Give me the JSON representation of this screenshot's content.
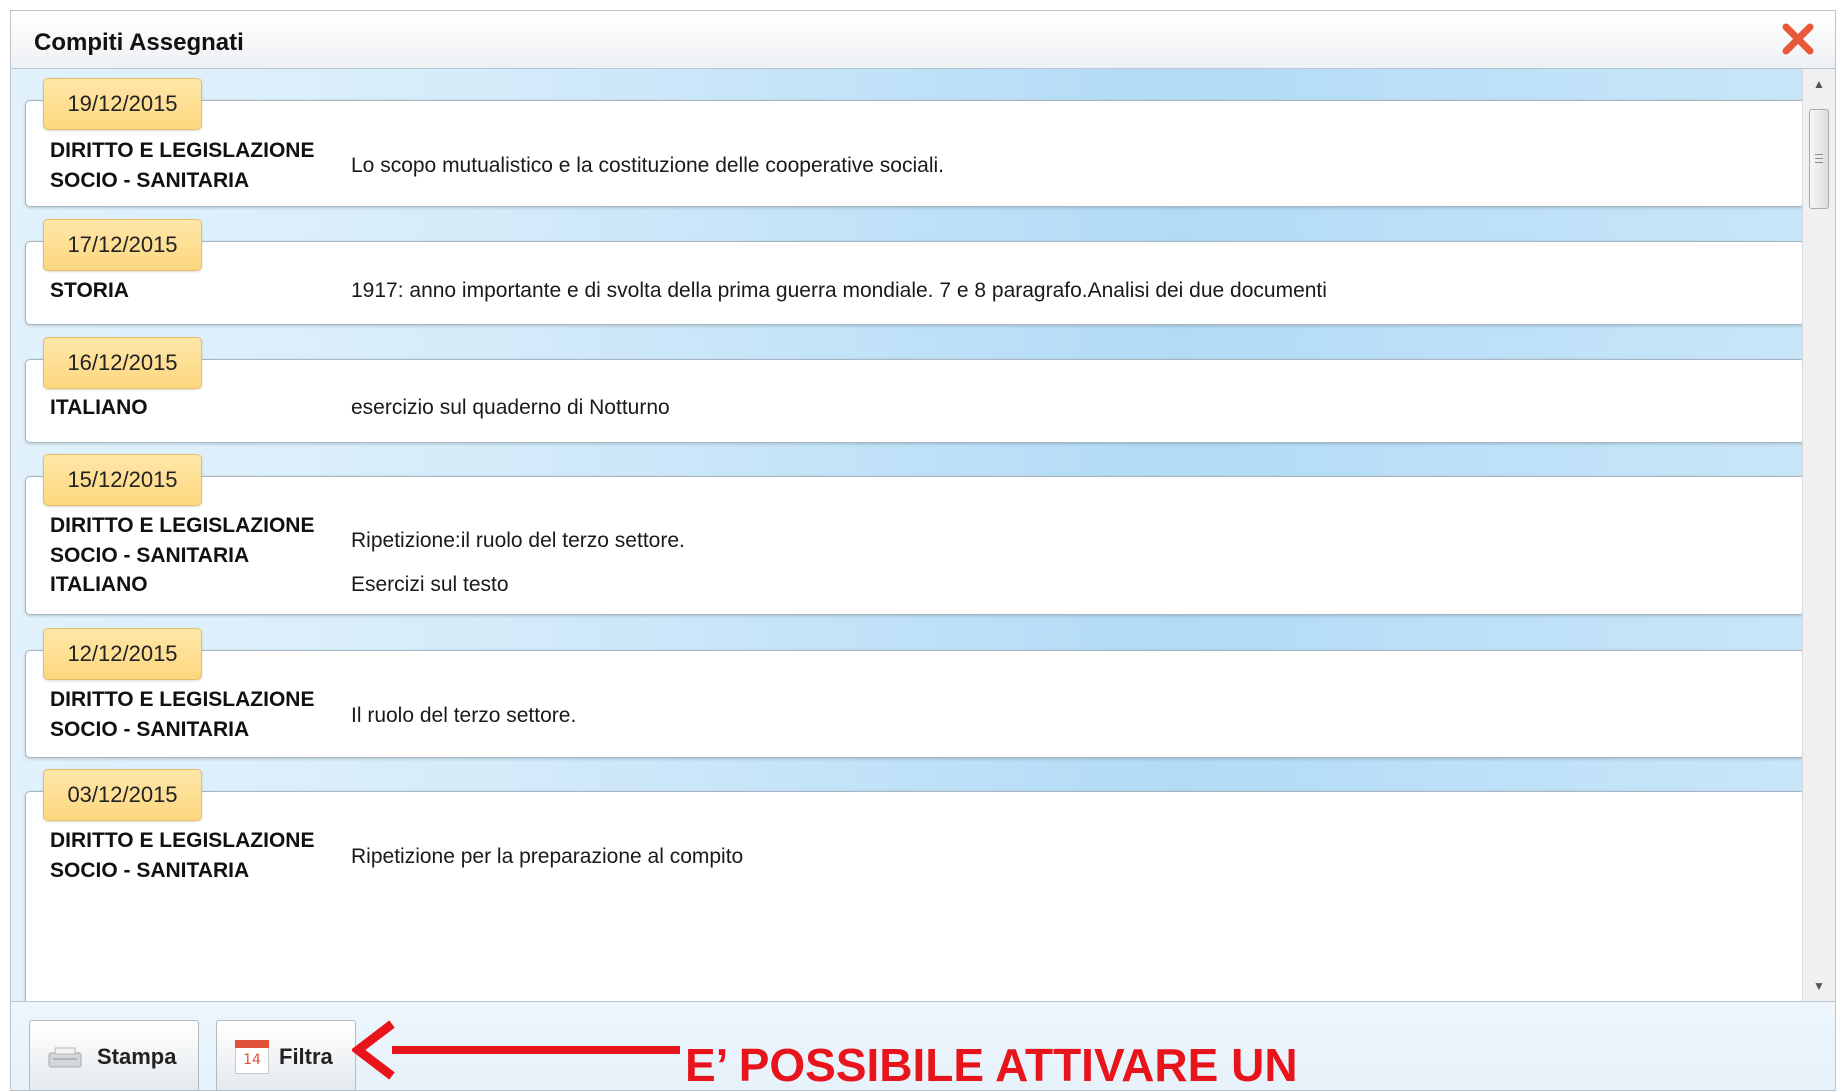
{
  "window": {
    "title": "Compiti Assegnati",
    "close_icon": "close-x-icon",
    "close_color": "#e8593a"
  },
  "entries": [
    {
      "date": "19/12/2015",
      "items": [
        {
          "subject": "DIRITTO E LEGISLAZIONE\nSOCIO - SANITARIA",
          "description": "Lo scopo mutualistico e la costituzione delle cooperative sociali."
        }
      ]
    },
    {
      "date": "17/12/2015",
      "items": [
        {
          "subject": "STORIA",
          "description": "1917: anno importante e di svolta della prima guerra mondiale. 7 e 8 paragrafo.Analisi dei due documenti"
        }
      ]
    },
    {
      "date": "16/12/2015",
      "items": [
        {
          "subject": "ITALIANO",
          "description": "esercizio sul quaderno di Notturno"
        }
      ]
    },
    {
      "date": "15/12/2015",
      "items": [
        {
          "subject": "DIRITTO E LEGISLAZIONE\nSOCIO - SANITARIA",
          "description": "Ripetizione:il ruolo del terzo settore."
        },
        {
          "subject": "ITALIANO",
          "description": "Esercizi sul testo"
        }
      ]
    },
    {
      "date": "12/12/2015",
      "items": [
        {
          "subject": "DIRITTO E LEGISLAZIONE\nSOCIO - SANITARIA",
          "description": "Il ruolo del terzo settore."
        }
      ]
    },
    {
      "date": "03/12/2015",
      "items": [
        {
          "subject": "DIRITTO E LEGISLAZIONE\nSOCIO - SANITARIA",
          "description": "Ripetizione per la preparazione al compito"
        }
      ]
    }
  ],
  "footer": {
    "print_label": "Stampa",
    "print_icon": "printer-icon",
    "filter_label": "Filtra",
    "filter_icon": "calendar-icon",
    "filter_icon_day": "14"
  },
  "annotation": {
    "text": "E’ POSSIBILE ATTIVARE UN",
    "color": "#e8141b"
  }
}
